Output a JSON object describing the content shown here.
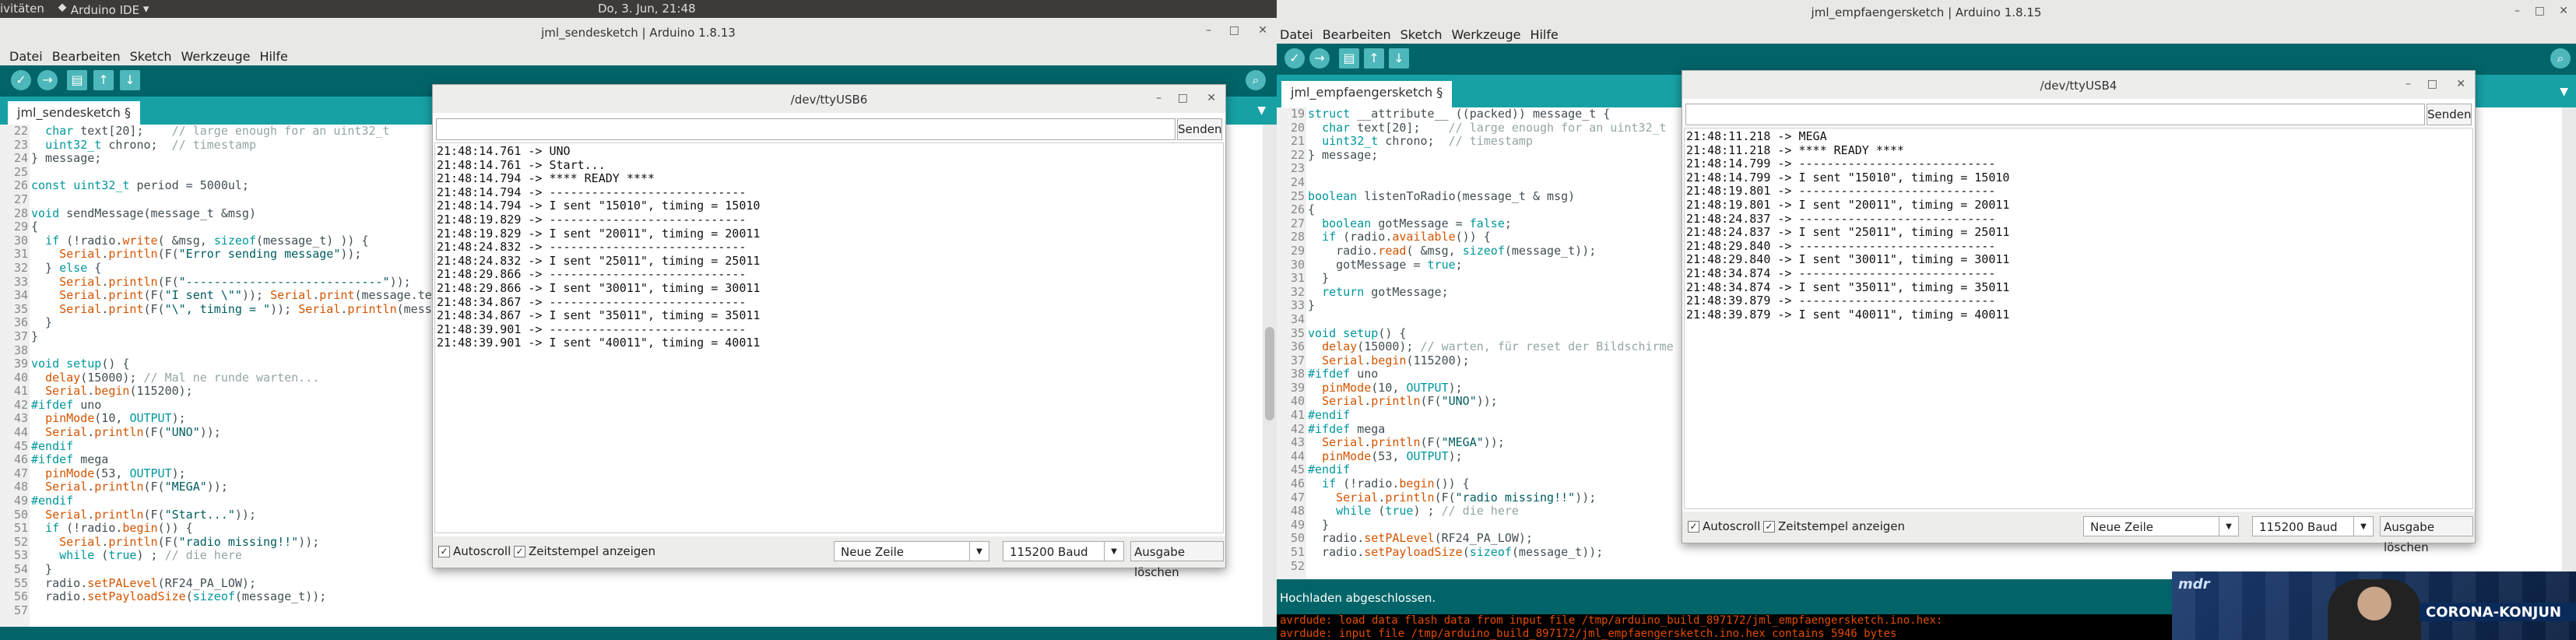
{
  "topbar": {
    "activities": "ivitäten",
    "app_menu": "Arduino IDE",
    "datetime": "Do,  3. Jun, 21:48"
  },
  "left_window": {
    "title": "jml_sendesketch | Arduino 1.8.13",
    "menu": [
      "Datei",
      "Bearbeiten",
      "Sketch",
      "Werkzeuge",
      "Hilfe"
    ],
    "tab": "jml_sendesketch §",
    "line_numbers": "22\n23\n24\n25\n26\n27\n28\n29\n30\n31\n32\n33\n34\n35\n36\n37\n38\n39\n40\n41\n42\n43\n44\n45\n46\n47\n48\n49\n50\n51\n52\n53\n54\n55\n56\n57"
  },
  "left_serial": {
    "title": "/dev/ttyUSB6",
    "send_label": "Senden",
    "output": "21:48:14.761 -> UNO\n21:48:14.761 -> Start...\n21:48:14.794 -> **** READY ****\n21:48:14.794 -> ----------------------------\n21:48:14.794 -> I sent \"15010\", timing = 15010\n21:48:19.829 -> ----------------------------\n21:48:19.829 -> I sent \"20011\", timing = 20011\n21:48:24.832 -> ----------------------------\n21:48:24.832 -> I sent \"25011\", timing = 25011\n21:48:29.866 -> ----------------------------\n21:48:29.866 -> I sent \"30011\", timing = 30011\n21:48:34.867 -> ----------------------------\n21:48:34.867 -> I sent \"35011\", timing = 35011\n21:48:39.901 -> ----------------------------\n21:48:39.901 -> I sent \"40011\", timing = 40011",
    "autoscroll": "Autoscroll",
    "timestamp": "Zeitstempel anzeigen",
    "line_ending": "Neue Zeile",
    "baud": "115200 Baud",
    "clear_label": "Ausgabe löschen"
  },
  "right_window": {
    "title": "jml_empfaengersketch | Arduino 1.8.15",
    "menu": [
      "Datei",
      "Bearbeiten",
      "Sketch",
      "Werkzeuge",
      "Hilfe"
    ],
    "tab": "jml_empfaengersketch §",
    "line_numbers": "19\n20\n21\n22\n23\n24\n25\n26\n27\n28\n29\n30\n31\n32\n33\n34\n35\n36\n37\n38\n39\n40\n41\n42\n43\n44\n45\n46\n47\n48\n49\n50\n51\n52",
    "status": "Hochladen abgeschlossen.",
    "console": "avrdude: load data flash data from input file /tmp/arduino_build_897172/jml_empfaengersketch.ino.hex:\navrdude: input file /tmp/arduino_build_897172/jml_empfaengersketch.ino.hex contains 5946 bytes"
  },
  "right_serial": {
    "title": "/dev/ttyUSB4",
    "send_label": "Senden",
    "output": "21:48:11.218 -> MEGA\n21:48:11.218 -> **** READY ****\n21:48:14.799 -> ----------------------------\n21:48:14.799 -> I sent \"15010\", timing = 15010\n21:48:19.801 -> ----------------------------\n21:48:19.801 -> I sent \"20011\", timing = 20011\n21:48:24.837 -> ----------------------------\n21:48:24.837 -> I sent \"25011\", timing = 25011\n21:48:29.840 -> ----------------------------\n21:48:29.840 -> I sent \"30011\", timing = 30011\n21:48:34.874 -> ----------------------------\n21:48:34.874 -> I sent \"35011\", timing = 35011\n21:48:39.879 -> ----------------------------\n21:48:39.879 -> I sent \"40011\", timing = 40011",
    "autoscroll": "Autoscroll",
    "timestamp": "Zeitstempel anzeigen",
    "line_ending": "Neue Zeile",
    "baud": "115200 Baud",
    "clear_label": "Ausgabe löschen"
  },
  "video": {
    "caption": "CORONA-KONJUN",
    "logo": "mdr"
  }
}
